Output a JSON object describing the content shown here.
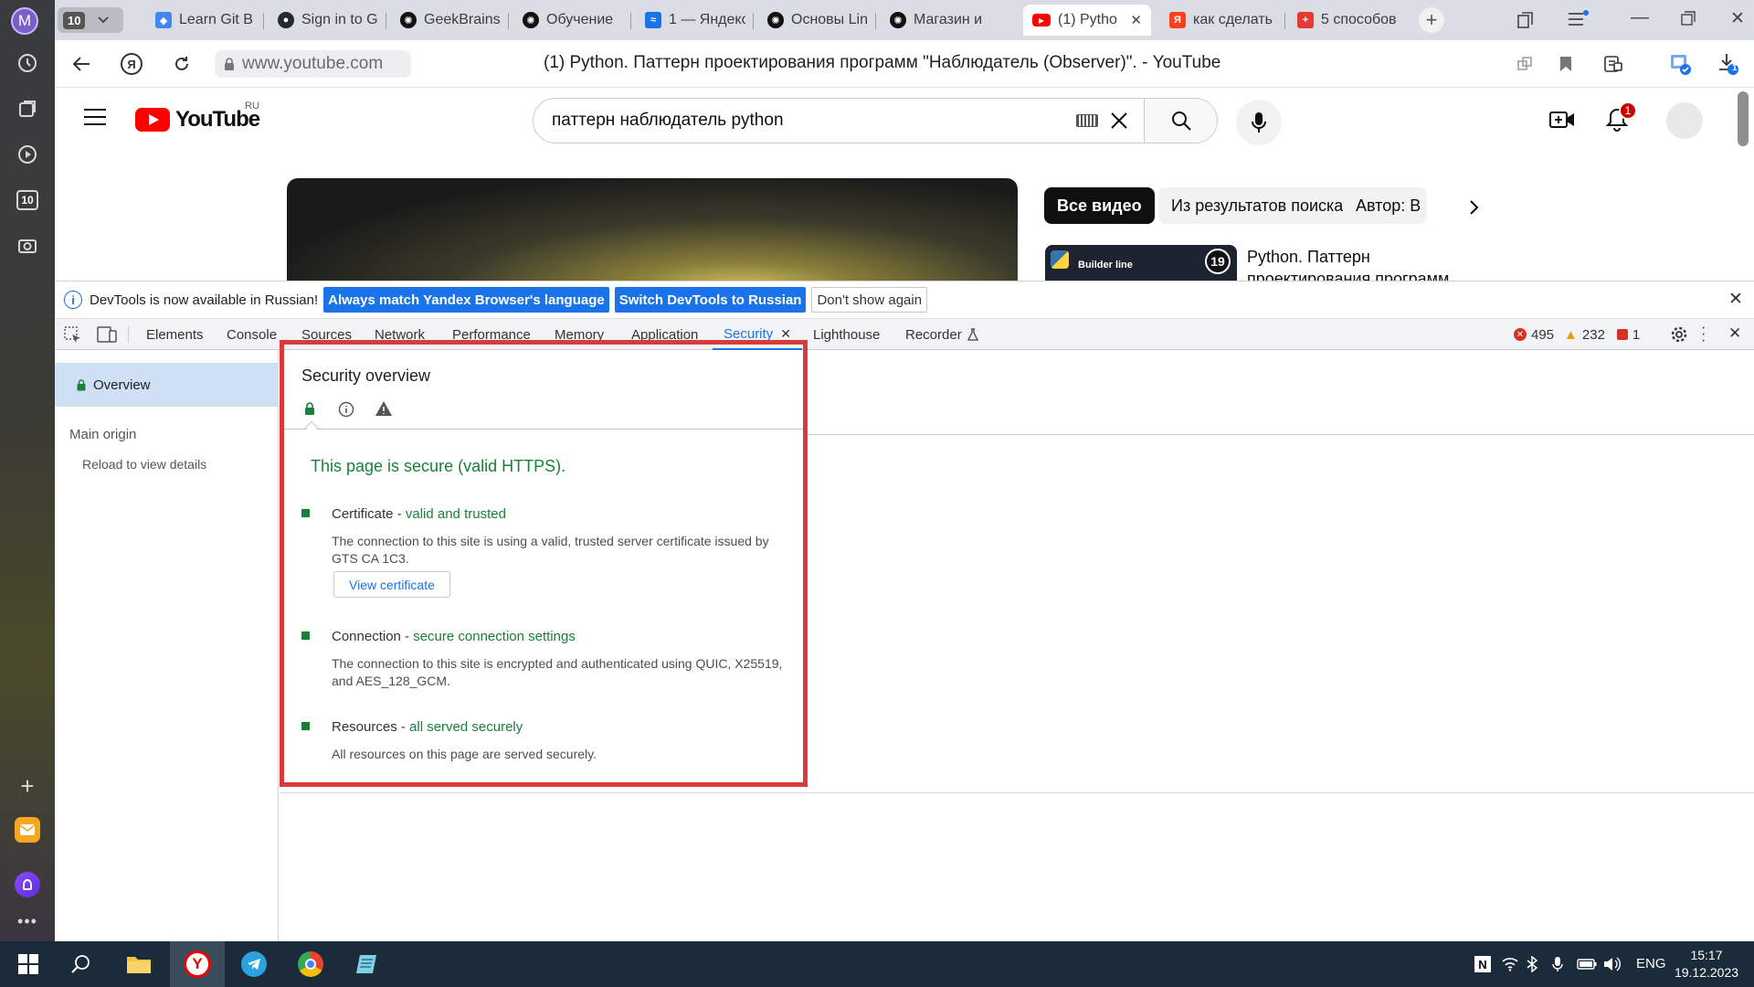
{
  "sidebar": {
    "avatar_letter": "M",
    "tab_count": "10"
  },
  "tabs": [
    {
      "label": "Learn Git B",
      "favicon_color": "#4285f4"
    },
    {
      "label": "Sign in to G",
      "favicon_color": "#24292f"
    },
    {
      "label": "GeekBrains",
      "favicon_color": "#111111"
    },
    {
      "label": "Обучение",
      "favicon_color": "#111111"
    },
    {
      "label": "1 — Яндекс",
      "favicon_color": "#1a73e8"
    },
    {
      "label": "Основы Lin",
      "favicon_color": "#111111"
    },
    {
      "label": "Магазин и",
      "favicon_color": "#111111"
    },
    {
      "label": "(1) Pytho",
      "favicon_color": "#ff0000"
    },
    {
      "label": "как сделать",
      "favicon_color": "#fc3f1d"
    },
    {
      "label": "5 способов",
      "favicon_color": "#e53935"
    }
  ],
  "tab_group_count": "10",
  "address": {
    "url": "www.youtube.com",
    "page_title": "(1) Python. Паттерн проектирования программ \"Наблюдатель (Observer)\". - YouTube",
    "download_badge": "1"
  },
  "youtube": {
    "logo_text": "YouTube",
    "region": "RU",
    "search_query": "паттерн наблюдатель python",
    "notification_count": "1",
    "chips": [
      "Все видео",
      "Из результатов поиска",
      "Автор: B"
    ],
    "recommendation_title": "Python. Паттерн проектирования программ",
    "thumb_label": "Builder line",
    "thumb_badge": "19"
  },
  "devtools": {
    "infobar_text": "DevTools is now available in Russian!",
    "infobar_btn_match": "Always match Yandex Browser's language",
    "infobar_btn_switch": "Switch DevTools to Russian",
    "infobar_btn_dismiss": "Don't show again",
    "tabs": [
      "Elements",
      "Console",
      "Sources",
      "Network",
      "Performance",
      "Memory",
      "Application",
      "Security",
      "Lighthouse",
      "Recorder"
    ],
    "selected_tab": "Security",
    "errors": "495",
    "warnings": "232",
    "issues": "1",
    "side": {
      "overview": "Overview",
      "main_origin": "Main origin",
      "reload": "Reload to view details"
    },
    "security": {
      "title": "Security overview",
      "headline": "This page is secure (valid HTTPS).",
      "cert_label": "Certificate - ",
      "cert_status": "valid and trusted",
      "cert_desc": "The connection to this site is using a valid, trusted server certificate issued by GTS CA 1C3.",
      "view_cert": "View certificate",
      "conn_label": "Connection - ",
      "conn_status": "secure connection settings",
      "conn_desc": "The connection to this site is encrypted and authenticated using QUIC, X25519, and AES_128_GCM.",
      "res_label": "Resources - ",
      "res_status": "all served securely",
      "res_desc": "All resources on this page are served securely."
    }
  },
  "taskbar": {
    "lang": "ENG",
    "time": "15:17",
    "date": "19.12.2023"
  },
  "colors": {
    "secure_green": "#188038",
    "devtools_blue": "#1a73e8",
    "highlight_red": "#d93b3b",
    "youtube_red": "#ff0000"
  }
}
